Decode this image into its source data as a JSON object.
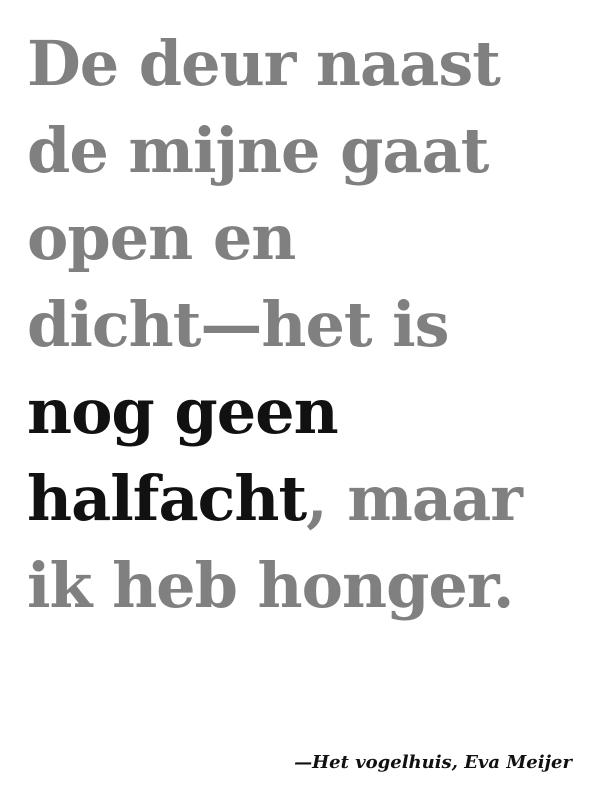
{
  "quote": {
    "line1": "De deur naast",
    "line2": "de mijne gaat",
    "line3": "open en",
    "line4": "dicht—het is",
    "line5": "nog geen",
    "line6_dark": "halfacht",
    "line6_grey": ", maar",
    "line7": "ik heb honger."
  },
  "attribution": "—Het vogelhuis, Eva Meijer",
  "colors": {
    "grey_text": "#808080",
    "dark_text": "#111111",
    "background": "#ffffff"
  }
}
